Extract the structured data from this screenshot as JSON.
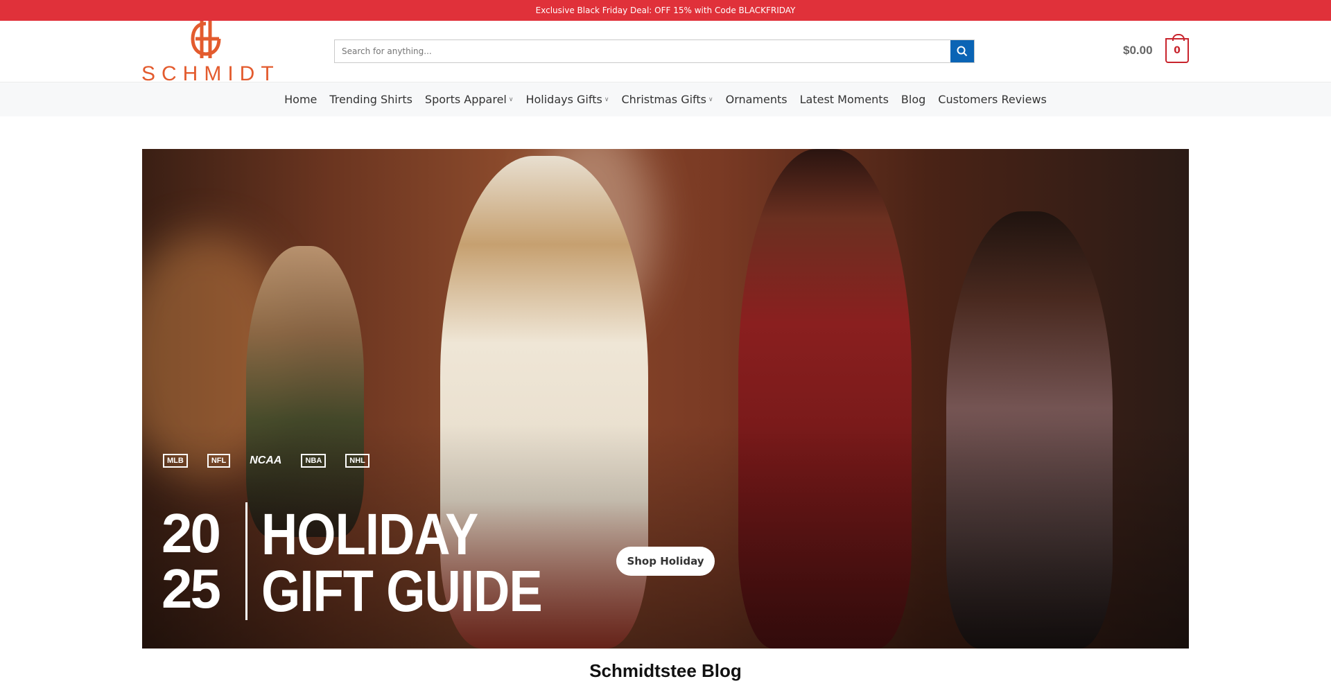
{
  "promo_bar": {
    "text": "Exclusive Black Friday Deal: OFF 15% with Code BLACKFRIDAY"
  },
  "logo": {
    "text": "SCHMIDT",
    "color": "#e35b2e"
  },
  "search": {
    "placeholder": "Search for anything...",
    "icon": "search-icon"
  },
  "cart": {
    "total": "$0.00",
    "count": "0"
  },
  "nav": {
    "items": [
      {
        "label": "Home",
        "has_dropdown": false
      },
      {
        "label": "Trending Shirts",
        "has_dropdown": false
      },
      {
        "label": "Sports Apparel",
        "has_dropdown": true
      },
      {
        "label": "Holidays Gifts",
        "has_dropdown": true
      },
      {
        "label": "Christmas Gifts",
        "has_dropdown": true
      },
      {
        "label": "Ornaments",
        "has_dropdown": false
      },
      {
        "label": "Latest Moments",
        "has_dropdown": false
      },
      {
        "label": "Blog",
        "has_dropdown": false
      },
      {
        "label": "Customers Reviews",
        "has_dropdown": false
      }
    ]
  },
  "hero": {
    "leagues": [
      "MLB",
      "NFL",
      "NCAA",
      "NBA",
      "NHL"
    ],
    "year_top": "20",
    "year_bottom": "25",
    "headline_1": "HOLIDAY",
    "headline_2": "GIFT GUIDE",
    "cta": "Shop Holiday"
  },
  "section": {
    "title": "Schmidtstee Blog"
  },
  "colors": {
    "promo": "#e0313a",
    "search_button": "#0a64b5",
    "cart": "#c8232c"
  }
}
